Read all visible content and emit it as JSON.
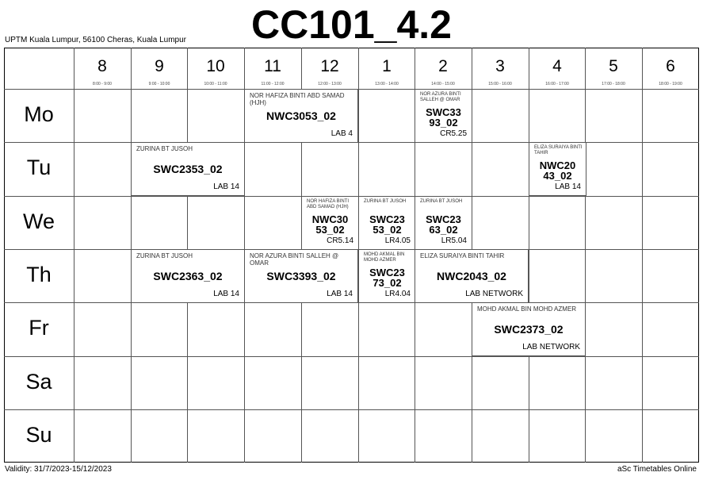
{
  "title": "CC101_4.2",
  "school": "UPTM Kuala Lumpur, 56100 Cheras, Kuala Lumpur",
  "validity": "Validity: 31/7/2023-15/12/2023",
  "credit": "aSc Timetables Online",
  "periods": [
    {
      "label": "8",
      "time": "8:00 - 9:00"
    },
    {
      "label": "9",
      "time": "9:00 - 10:00"
    },
    {
      "label": "10",
      "time": "10:00 - 11:00"
    },
    {
      "label": "11",
      "time": "11:00 - 12:00"
    },
    {
      "label": "12",
      "time": "12:00 - 13:00"
    },
    {
      "label": "1",
      "time": "13:00 - 14:00"
    },
    {
      "label": "2",
      "time": "14:00 - 15:00"
    },
    {
      "label": "3",
      "time": "15:00 - 16:00"
    },
    {
      "label": "4",
      "time": "16:00 - 17:00"
    },
    {
      "label": "5",
      "time": "17:00 - 18:00"
    },
    {
      "label": "6",
      "time": "18:00 - 19:00"
    }
  ],
  "days": [
    "Mo",
    "Tu",
    "We",
    "Th",
    "Fr",
    "Sa",
    "Su"
  ],
  "lessons": [
    {
      "day": 0,
      "period": 3,
      "span": 2,
      "teacher": "NOR HAFIZA BINTI ABD SAMAD (HJH)",
      "subject": "NWC3053_02",
      "room": "LAB 4"
    },
    {
      "day": 0,
      "period": 6,
      "span": 1,
      "teacher": "NOR AZURA BINTI SALLEH @ OMAR",
      "subject": "SWC3393_02",
      "room": "CR5.25"
    },
    {
      "day": 1,
      "period": 1,
      "span": 2,
      "teacher": "ZURINA BT JUSOH",
      "subject": "SWC2353_02",
      "room": "LAB 14"
    },
    {
      "day": 1,
      "period": 8,
      "span": 1,
      "teacher": "ELIZA SURAIYA BINTI TAHIR",
      "subject": "NWC2043_02",
      "room": "LAB 14"
    },
    {
      "day": 2,
      "period": 4,
      "span": 1,
      "teacher": "NOR HAFIZA BINTI ABD SAMAD (HJH)",
      "subject": "NWC3053_02",
      "room": "CR5.14"
    },
    {
      "day": 2,
      "period": 5,
      "span": 1,
      "teacher": "ZURINA BT JUSOH",
      "subject": "SWC2353_02",
      "room": "LR4.05"
    },
    {
      "day": 2,
      "period": 6,
      "span": 1,
      "teacher": "ZURINA BT JUSOH",
      "subject": "SWC2363_02",
      "room": "LR5.04"
    },
    {
      "day": 3,
      "period": 1,
      "span": 2,
      "teacher": "ZURINA BT JUSOH",
      "subject": "SWC2363_02",
      "room": "LAB 14"
    },
    {
      "day": 3,
      "period": 3,
      "span": 2,
      "teacher": "NOR AZURA BINTI SALLEH @ OMAR",
      "subject": "SWC3393_02",
      "room": "LAB 14"
    },
    {
      "day": 3,
      "period": 5,
      "span": 1,
      "teacher": "MOHD AKMAL BIN MOHD AZMER",
      "subject": "SWC2373_02",
      "room": "LR4.04"
    },
    {
      "day": 3,
      "period": 6,
      "span": 2,
      "teacher": "ELIZA SURAIYA BINTI TAHIR",
      "subject": "NWC2043_02",
      "room": "LAB NETWORK"
    },
    {
      "day": 4,
      "period": 7,
      "span": 2,
      "teacher": "MOHD AKMAL BIN MOHD AZMER",
      "subject": "SWC2373_02",
      "room": "LAB NETWORK"
    }
  ]
}
